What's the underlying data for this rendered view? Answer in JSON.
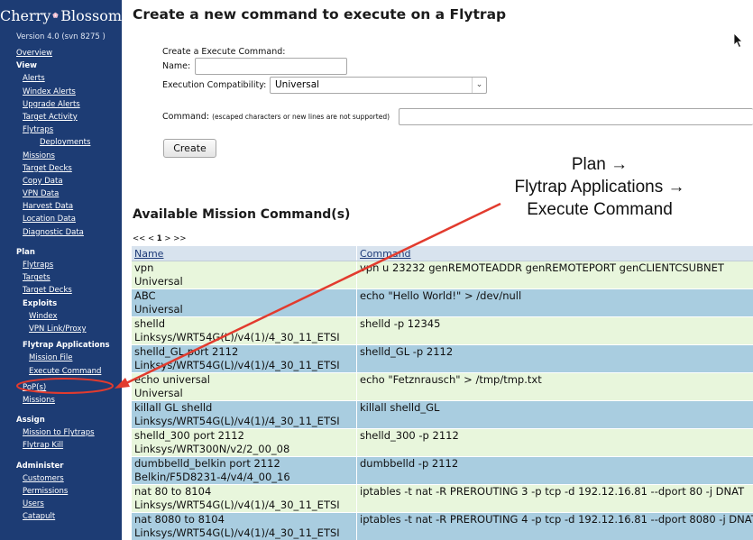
{
  "sidebar": {
    "logo_left": "Cherry",
    "logo_right": "Blossom",
    "version": "Version 4.0 (svn 8275 )",
    "overview": "Overview",
    "view": {
      "title": "View",
      "items": [
        "Alerts",
        "Windex Alerts",
        "Upgrade Alerts",
        "Target Activity",
        "Flytraps"
      ],
      "sub_item": "Deployments",
      "items2": [
        "Missions",
        "Target Decks",
        "Copy Data",
        "VPN Data",
        "Harvest Data",
        "Location Data",
        "Diagnostic Data"
      ]
    },
    "plan": {
      "title": "Plan",
      "items": [
        "Flytraps",
        "Targets",
        "Target Decks"
      ],
      "exploits_title": "Exploits",
      "exploits": [
        "Windex",
        "VPN Link/Proxy"
      ],
      "apps_title": "Flytrap Applications",
      "apps": [
        "Mission File",
        "Execute Command"
      ],
      "items2": [
        "PoP(s)",
        "Missions"
      ]
    },
    "assign": {
      "title": "Assign",
      "items": [
        "Mission to Flytraps",
        "Flytrap Kill"
      ]
    },
    "administer": {
      "title": "Administer",
      "items": [
        "Customers",
        "Permissions",
        "Users",
        "Catapult"
      ]
    }
  },
  "main": {
    "title": "Create a new command to execute on a Flytrap",
    "form": {
      "heading": "Create a Execute Command:",
      "name_label": "Name:",
      "name_value": "",
      "compat_label": "Execution Compatibility:",
      "compat_value": "Universal",
      "command_label": "Command:",
      "command_note": "(escaped characters or new lines are not supported)",
      "command_value": "",
      "create_label": "Create"
    },
    "section_title": "Available Mission Command(s)",
    "pager": {
      "prev": "<< <",
      "current": "1",
      "next": "> >>"
    },
    "table": {
      "headers": [
        "Name",
        "Command"
      ],
      "rows": [
        {
          "name": "vpn",
          "compat": "Universal",
          "command": "vpn u 23232 genREMOTEADDR genREMOTEPORT genCLIENTCSUBNET"
        },
        {
          "name": "ABC",
          "compat": "Universal",
          "command": "echo \"Hello World!\" > /dev/null"
        },
        {
          "name": "shelld",
          "compat": "Linksys/WRT54G(L)/v4(1)/4_30_11_ETSI",
          "command": "shelld -p 12345"
        },
        {
          "name": "shelld_GL port 2112",
          "compat": "Linksys/WRT54G(L)/v4(1)/4_30_11_ETSI",
          "command": "shelld_GL -p 2112"
        },
        {
          "name": "echo universal",
          "compat": "Universal",
          "command": "echo \"Fetznrausch\" > /tmp/tmp.txt"
        },
        {
          "name": "killall GL shelld",
          "compat": "Linksys/WRT54G(L)/v4(1)/4_30_11_ETSI",
          "command": "killall shelld_GL"
        },
        {
          "name": "shelld_300 port 2112",
          "compat": "Linksys/WRT300N/v2/2_00_08",
          "command": "shelld_300 -p 2112"
        },
        {
          "name": "dumbbelld_belkin port 2112",
          "compat": "Belkin/F5D8231-4/v4/4_00_16",
          "command": "dumbbelld -p 2112"
        },
        {
          "name": "nat 80 to 8104",
          "compat": "Linksys/WRT54G(L)/v4(1)/4_30_11_ETSI",
          "command": "iptables -t nat -R PREROUTING 3 -p tcp -d 192.12.16.81 --dport 80 -j DNAT"
        },
        {
          "name": "nat 8080 to 8104",
          "compat": "Linksys/WRT54G(L)/v4(1)/4_30_11_ETSI",
          "command": "iptables -t nat -R PREROUTING 4 -p tcp -d 192.12.16.81 --dport 8080 -j DNAT"
        }
      ]
    }
  },
  "annotation": {
    "line1": "Plan →",
    "line2": "Flytrap Applications →",
    "line3": "Execute Command",
    "color": "#e23b2e"
  },
  "colors": {
    "sidebar_bg": "#1d3c74",
    "row_green": "#e8f6dc",
    "row_blue": "#a9cde0",
    "header_bg": "#d8e3ee"
  }
}
